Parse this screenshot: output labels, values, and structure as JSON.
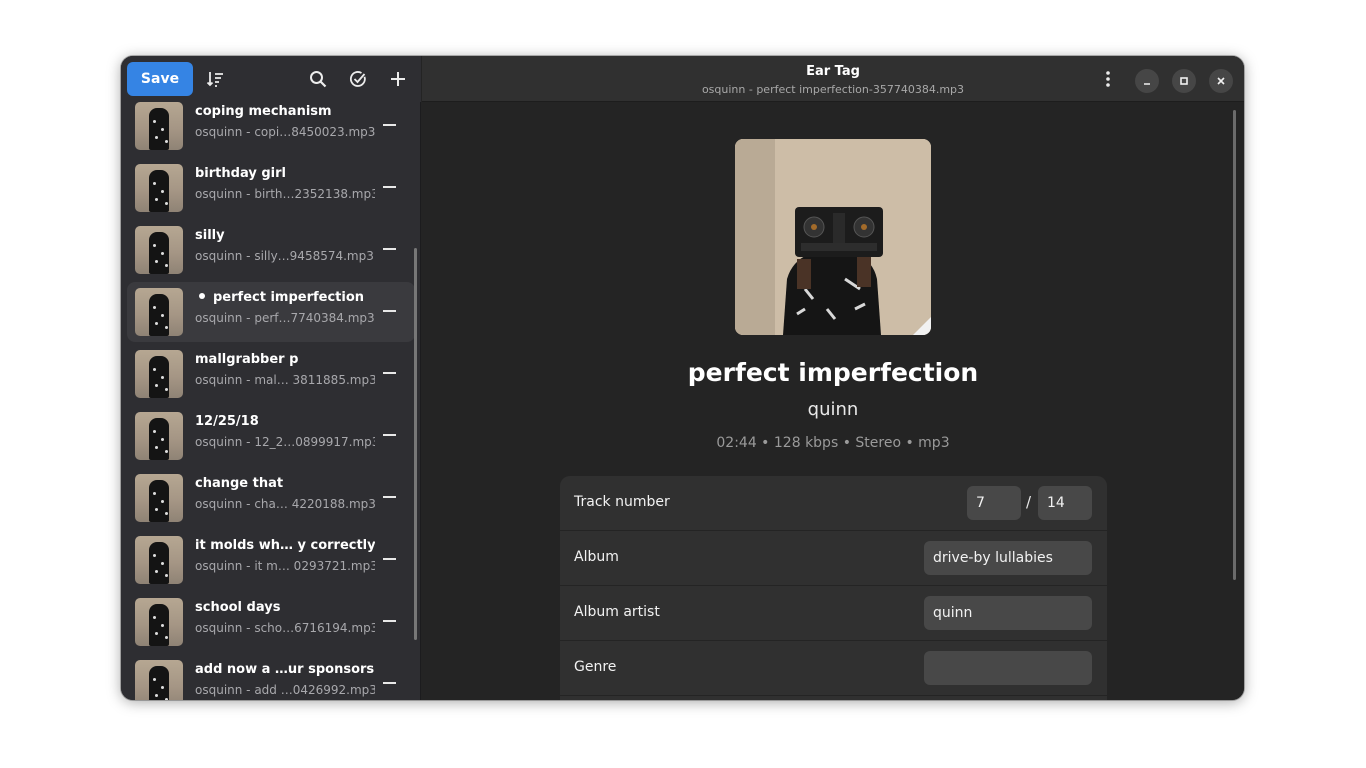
{
  "toolbar": {
    "save_label": "Save"
  },
  "window": {
    "title": "Ear Tag",
    "subtitle": "osquinn - perfect imperfection-357740384.mp3"
  },
  "files": [
    {
      "title": "coping mechanism",
      "filename": "osquinn - copi…8450023.mp3",
      "selected": false
    },
    {
      "title": "birthday girl",
      "filename": "osquinn - birth…2352138.mp3",
      "selected": false
    },
    {
      "title": "silly",
      "filename": "osquinn - silly…9458574.mp3",
      "selected": false
    },
    {
      "title": "perfect imperfection",
      "filename": "osquinn - perf…7740384.mp3",
      "selected": true
    },
    {
      "title": "mallgrabber p",
      "filename": "osquinn - mal… 3811885.mp3",
      "selected": false
    },
    {
      "title": "12/25/18",
      "filename": "osquinn - 12_2…0899917.mp3",
      "selected": false
    },
    {
      "title": "change that",
      "filename": "osquinn - cha… 4220188.mp3",
      "selected": false
    },
    {
      "title": "it molds wh… y correctly",
      "filename": "osquinn - it m… 0293721.mp3",
      "selected": false
    },
    {
      "title": "school days",
      "filename": "osquinn - scho…6716194.mp3",
      "selected": false
    },
    {
      "title": "add now a …ur sponsors",
      "filename": "osquinn - add …0426992.mp3",
      "selected": false
    }
  ],
  "track": {
    "title": "perfect imperfection",
    "artist": "quinn",
    "meta": "02:44 • 128 kbps • Stereo • mp3"
  },
  "fields": {
    "track_number": {
      "label": "Track number",
      "number": "7",
      "slash": "/",
      "total": "14"
    },
    "album": {
      "label": "Album",
      "value": "drive-by lullabies"
    },
    "album_artist": {
      "label": "Album artist",
      "value": "quinn"
    },
    "genre": {
      "label": "Genre",
      "value": ""
    }
  },
  "colors": {
    "accent": "#3584e4",
    "window_bg": "#242424",
    "sidebar_bg": "#2e2e32"
  }
}
